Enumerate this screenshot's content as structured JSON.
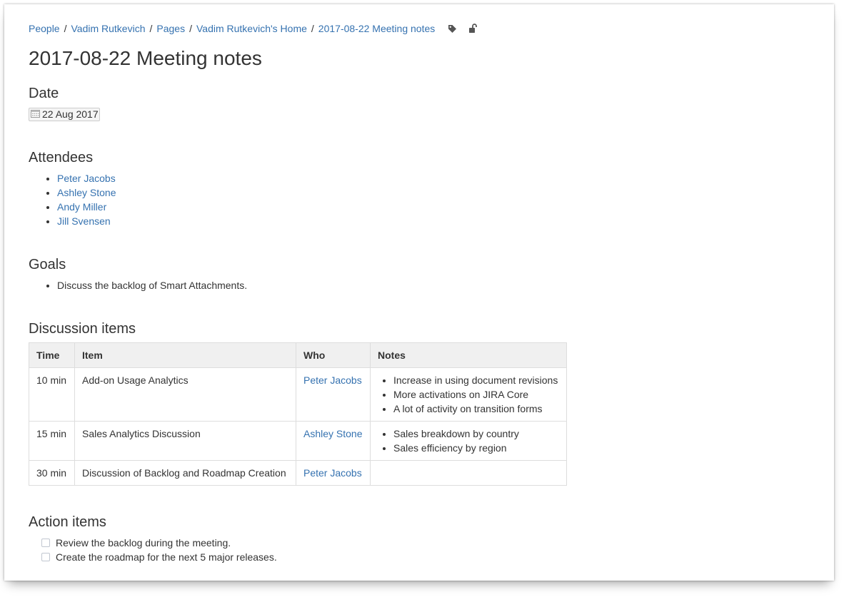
{
  "breadcrumbs": [
    "People",
    "Vadim Rutkevich",
    "Pages",
    "Vadim Rutkevich's Home",
    "2017-08-22 Meeting notes"
  ],
  "page_title": "2017-08-22 Meeting notes",
  "sections": {
    "date": {
      "heading": "Date",
      "value": "22 Aug 2017"
    },
    "attendees": {
      "heading": "Attendees",
      "items": [
        "Peter Jacobs",
        "Ashley Stone",
        "Andy Miller",
        "Jill Svensen"
      ]
    },
    "goals": {
      "heading": "Goals",
      "items": [
        "Discuss the backlog of Smart Attachments."
      ]
    },
    "discussion": {
      "heading": "Discussion items",
      "columns": [
        "Time",
        "Item",
        "Who",
        "Notes"
      ],
      "rows": [
        {
          "time": "10 min",
          "item": "Add-on Usage Analytics",
          "who": "Peter Jacobs",
          "notes": [
            "Increase in using document revisions",
            "More activations on JIRA Core",
            "A lot of activity on transition forms"
          ]
        },
        {
          "time": "15 min",
          "item": "Sales Analytics Discussion",
          "who": "Ashley Stone",
          "notes": [
            "Sales breakdown by country",
            "Sales efficiency by region"
          ]
        },
        {
          "time": "30 min",
          "item": "Discussion of Backlog and Roadmap Creation",
          "who": "Peter Jacobs",
          "notes": []
        }
      ]
    },
    "actions": {
      "heading": "Action items",
      "items": [
        {
          "label": "Review the backlog during the meeting.",
          "checked": false
        },
        {
          "label": "Create the roadmap for the next 5 major releases.",
          "checked": false
        }
      ]
    }
  },
  "icons": {
    "labels": "tag-icon",
    "restrictions": "unlock-icon",
    "date": "calendar-icon"
  },
  "colors": {
    "link": "#3572b0",
    "text": "#333333",
    "table_header_bg": "#f0f0f0",
    "border": "#dddddd"
  }
}
